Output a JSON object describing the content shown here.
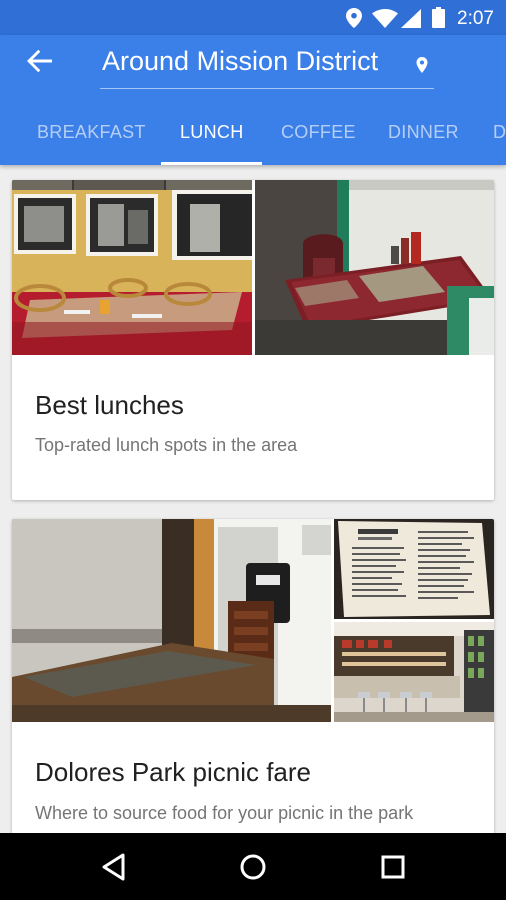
{
  "status_bar": {
    "time": "2:07",
    "icons": [
      "location-icon",
      "wifi-icon",
      "signal-icon",
      "battery-icon"
    ],
    "background": "#2f6fd6"
  },
  "header": {
    "title": "Around Mission District",
    "back_icon": "arrow-left-icon",
    "location_icon": "map-pin-icon",
    "background": "#3b7fe8"
  },
  "tabs": [
    {
      "label": "BREAKFAST"
    },
    {
      "label": "LUNCH",
      "active": true
    },
    {
      "label": "COFFEE"
    },
    {
      "label": "DINNER"
    },
    {
      "label": "D"
    }
  ],
  "cards": [
    {
      "title": "Best lunches",
      "subtitle": "Top-rated lunch spots in the area",
      "images": [
        "cafe-interior-photo",
        "diner-table-photo"
      ]
    },
    {
      "title": "Dolores Park picnic fare",
      "subtitle": "Where to source food for your picnic in the park",
      "images": [
        "table-by-window-photo",
        "menu-board-photo",
        "bakery-counter-photo"
      ]
    }
  ],
  "nav_bar": {
    "buttons": [
      "back-triangle-icon",
      "home-circle-icon",
      "recents-square-icon"
    ]
  }
}
